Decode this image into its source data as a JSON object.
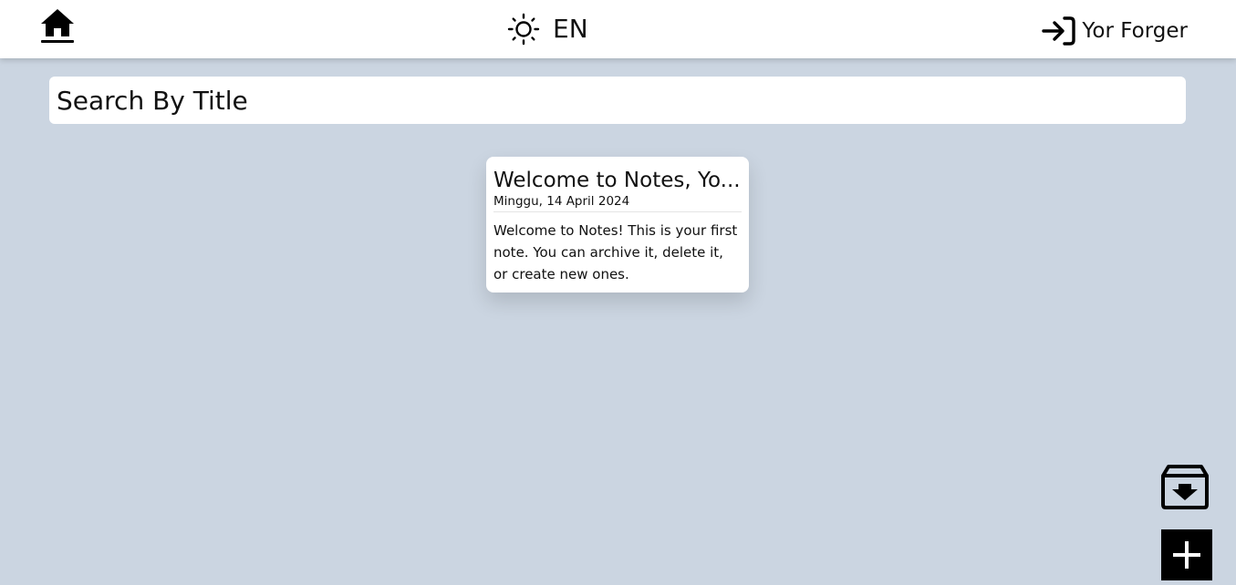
{
  "header": {
    "home_icon": "home-icon",
    "theme_icon": "sun-icon",
    "language": "EN",
    "login_icon": "login-icon",
    "user_name": "Yor Forger"
  },
  "search": {
    "placeholder": "Search By Title",
    "value": ""
  },
  "notes": [
    {
      "title": "Welcome to Notes, Yo...",
      "date": "Minggu, 14 April 2024",
      "body": "Welcome to Notes! This is your first note. You can archive it, delete it, or create new ones."
    }
  ],
  "actions": {
    "archive_icon": "archive-icon",
    "add_icon": "plus-icon"
  },
  "colors": {
    "background": "#cbd5e1",
    "header": "#ffffff",
    "card": "#ffffff",
    "add_button": "#000000"
  }
}
